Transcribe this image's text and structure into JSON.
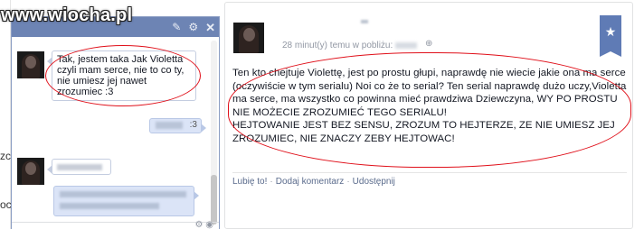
{
  "watermark": "www.wiocha.pl",
  "background_fragments": [
    "zc",
    "ocz"
  ],
  "chat": {
    "header_icons": [
      "pencil-icon",
      "gear-icon",
      "close-icon"
    ],
    "messages": [
      {
        "side": "left",
        "text": "Tak, jestem taka Jak Violetta czyli mam serce, nie to co ty, nie umiesz jej nawet zrozumiec :3"
      },
      {
        "side": "right",
        "text": ":3"
      },
      {
        "side": "left",
        "text": "[blurred]"
      },
      {
        "side": "right",
        "text": "[blurred]"
      }
    ],
    "footer_icons": [
      "settings-icon",
      "camera-icon"
    ]
  },
  "post": {
    "timestamp": "28 minut(y) temu w pobliżu:",
    "visibility": "globe-icon",
    "text": "Ten kto chejtuje Violettę, jest po prostu głupi, naprawdę nie wiecie jakie ona ma serce (oczywiście w tym serialu) Noi co że to serial? Ten serial naprawdę dużo uczy,Violetta ma serce, ma wszystko co powinna mieć prawdziwa Dziewczyna, WY PO PROSTU NIE MOŻECIE ZROZUMIEĆ TEGO SERIALU!\nHEJTOWANIE JEST BEZ SENSU, ZROZUM TO HEJTERZE, ZE NIE UMIESZ JEJ ZROZUMIEC, NIE ZNACZY ZEBY HEJTOWAC!",
    "actions": [
      "Lubię to!",
      "Dodaj komentarz",
      "Udostępnij"
    ],
    "ribbon_icon": "star-icon"
  },
  "colors": {
    "chat_header": "#6d84b4",
    "highlight": "#e0101a",
    "link": "#5a6b8c",
    "ribbon": "#5f7bb5"
  }
}
